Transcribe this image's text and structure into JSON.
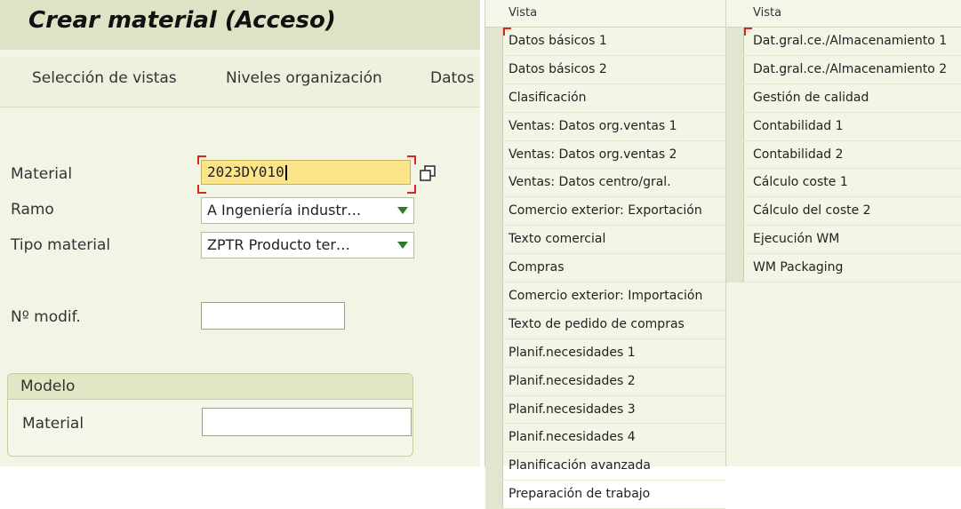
{
  "title": "Crear material (Acceso)",
  "toolbar": {
    "tab1": "Selección de vistas",
    "tab2": "Niveles organización",
    "tab3": "Datos"
  },
  "form": {
    "material_label": "Material",
    "material_value": "2023DY010",
    "ramo_label": "Ramo",
    "ramo_value": "A Ingeniería industr…",
    "tipo_label": "Tipo material",
    "tipo_value": "ZPTR Producto ter…",
    "modif_label": "Nº modif.",
    "modif_value": ""
  },
  "modelo": {
    "title": "Modelo",
    "material_label": "Material",
    "material_value": ""
  },
  "views_col1": {
    "header": "Vista",
    "items": [
      "Datos básicos 1",
      "Datos básicos 2",
      "Clasificación",
      "Ventas: Datos org.ventas 1",
      "Ventas: Datos org.ventas 2",
      "Ventas: Datos centro/gral.",
      "Comercio exterior: Exportación",
      "Texto comercial",
      "Compras",
      "Comercio exterior: Importación",
      "Texto de pedido de compras",
      "Planif.necesidades 1",
      "Planif.necesidades 2",
      "Planif.necesidades 3",
      "Planif.necesidades 4",
      "Planificación avanzada",
      "Preparación de trabajo"
    ]
  },
  "views_col2": {
    "header": "Vista",
    "items": [
      "Dat.gral.ce./Almacenamiento 1",
      "Dat.gral.ce./Almacenamiento 2",
      "Gestión de calidad",
      "Contabilidad 1",
      "Contabilidad 2",
      "Cálculo coste 1",
      "Cálculo del coste 2",
      "Ejecución WM",
      "WM Packaging"
    ]
  },
  "colors": {
    "title_bg": "#dde4c5",
    "panel_bg": "#f2f4e6",
    "focus_field": "#fce589",
    "dropdown_arrow": "#2a7d2a",
    "focus_marker": "#dd2222"
  }
}
